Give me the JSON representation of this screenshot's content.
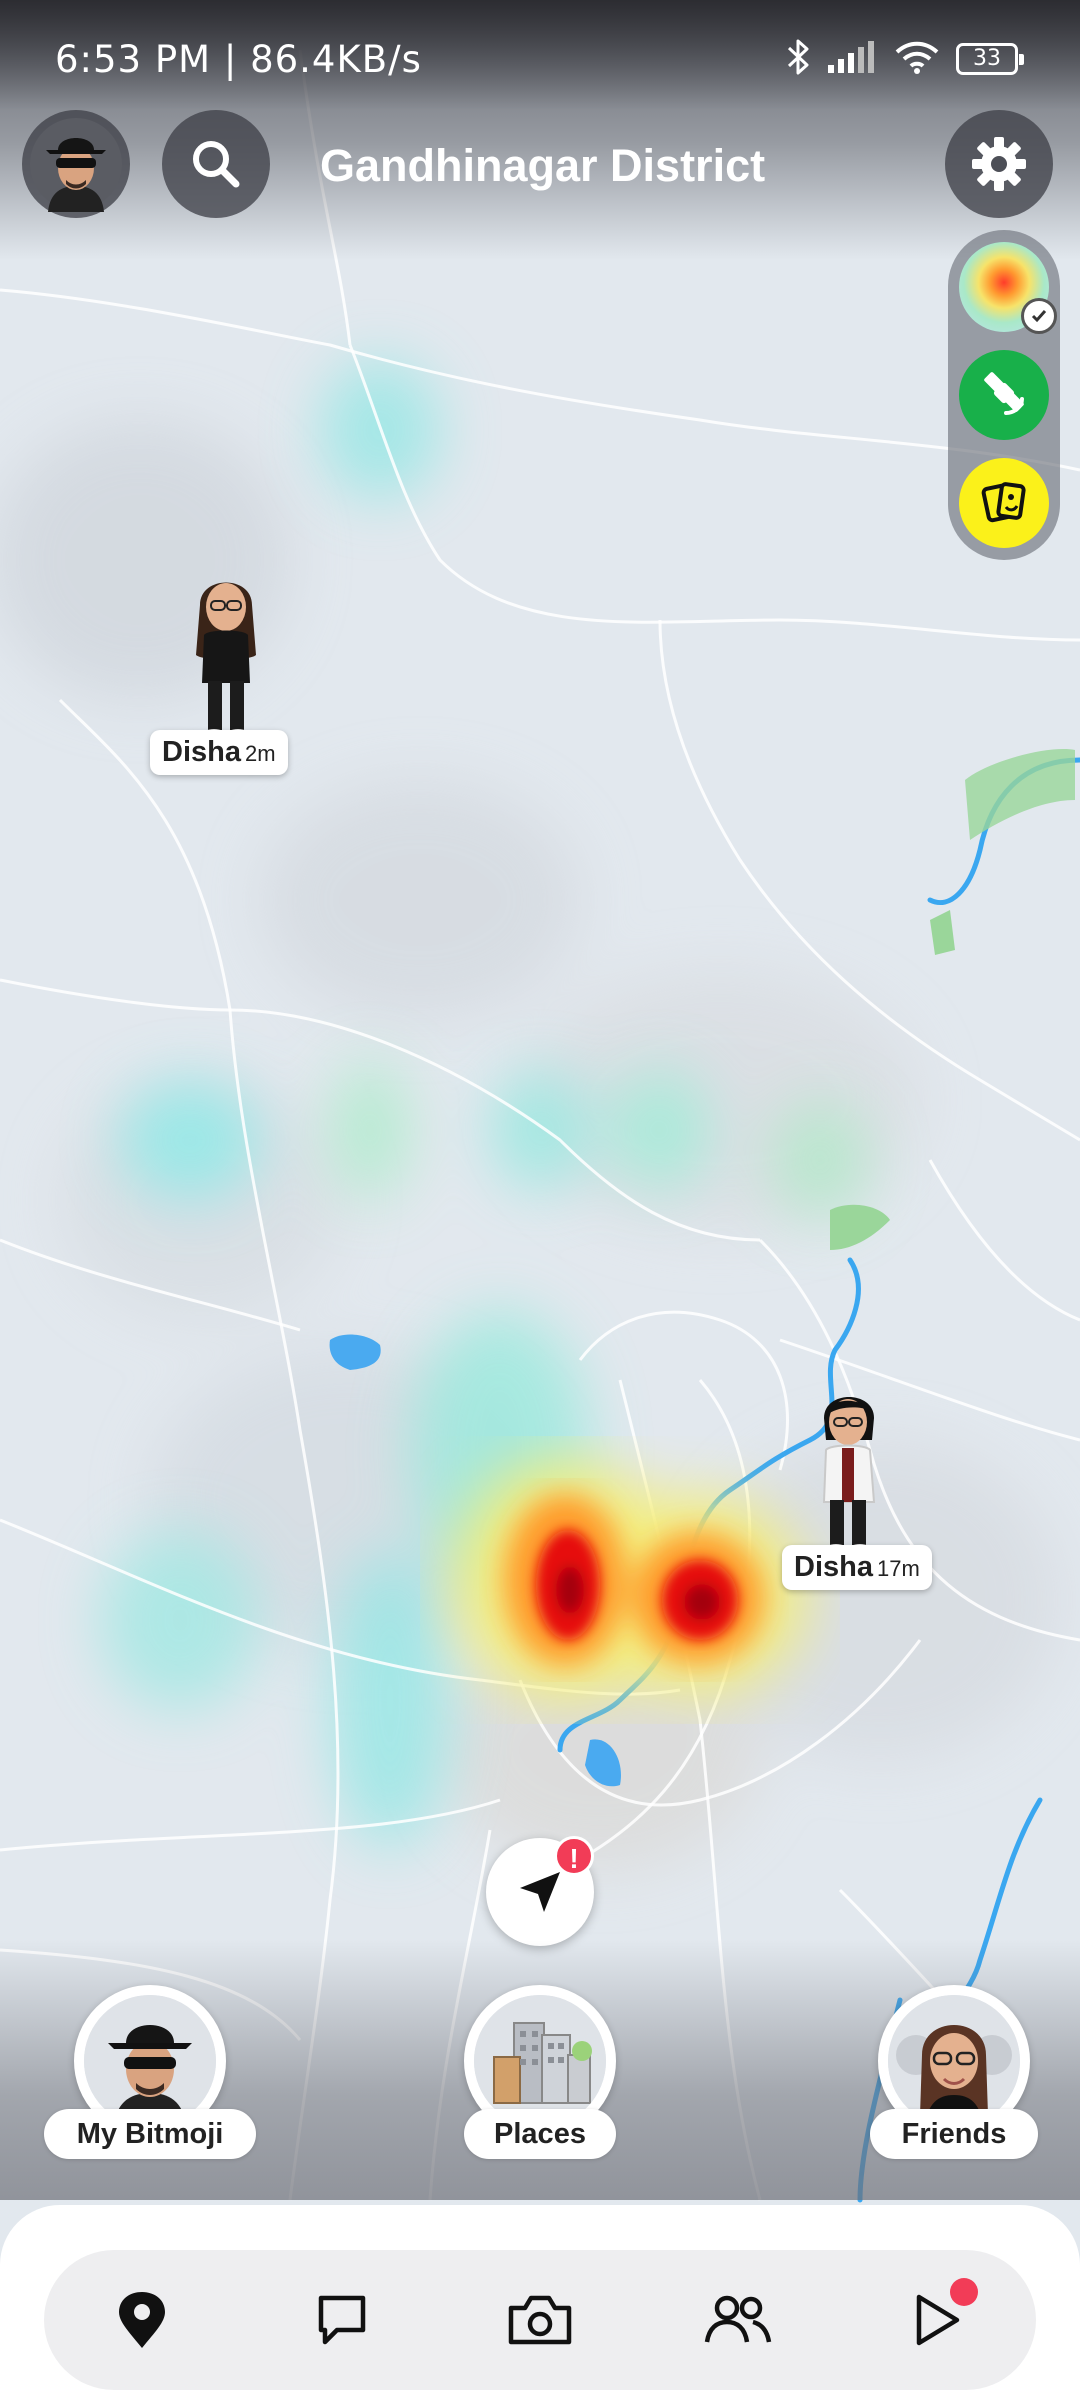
{
  "status_bar": {
    "time": "6:53 PM | 86.4KB/s",
    "battery": "33",
    "icons": [
      "bluetooth-icon",
      "signal-icon",
      "wifi-icon",
      "battery-icon"
    ]
  },
  "header": {
    "title": "Gandhinagar District",
    "left_buttons": [
      "my-avatar",
      "search-icon"
    ],
    "right_button": "gear-icon"
  },
  "map_layers": {
    "items": [
      "heatmap",
      "satellite",
      "memories"
    ],
    "selected": "heatmap"
  },
  "friends_on_map": [
    {
      "name": "Disha",
      "time": "2m"
    },
    {
      "name": "Disha",
      "time": "17m"
    }
  ],
  "locate_button": {
    "badge": "!"
  },
  "shortcuts": [
    {
      "label": "My Bitmoji"
    },
    {
      "label": "Places"
    },
    {
      "label": "Friends"
    }
  ],
  "bottom_nav": {
    "items": [
      "map",
      "chat",
      "camera",
      "friends",
      "spotlight"
    ],
    "active": "map",
    "notification_on": "spotlight"
  },
  "colors": {
    "accent_red": "#f23c57",
    "layer_green": "#18b04a",
    "layer_yellow": "#fbf11a"
  }
}
